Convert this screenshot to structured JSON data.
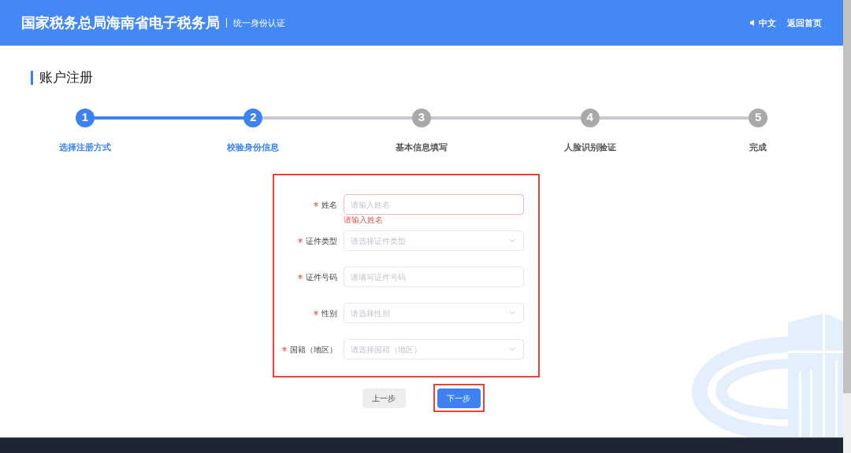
{
  "header": {
    "title": "国家税务总局海南省电子税务局",
    "subtitle": "统一身份认证",
    "language": "中文",
    "home_link": "返回首页"
  },
  "page_title": "账户注册",
  "steps": [
    {
      "number": "1",
      "label": "选择注册方式",
      "completed": true
    },
    {
      "number": "2",
      "label": "校验身份信息",
      "completed": true
    },
    {
      "number": "3",
      "label": "基本信息填写",
      "completed": false
    },
    {
      "number": "4",
      "label": "人脸识别验证",
      "completed": false
    },
    {
      "number": "5",
      "label": "完成",
      "completed": false
    }
  ],
  "form": {
    "highlighted": true,
    "fields": [
      {
        "kind": "input",
        "label": "姓名",
        "required": true,
        "placeholder": "请输入姓名",
        "invalid": true,
        "error": "请输入姓名"
      },
      {
        "kind": "select",
        "label": "证件类型",
        "required": true,
        "placeholder": "请选择证件类型",
        "invalid": false
      },
      {
        "kind": "input",
        "label": "证件号码",
        "required": true,
        "placeholder": "请填写证件号码",
        "invalid": false
      },
      {
        "kind": "select",
        "label": "性别",
        "required": true,
        "placeholder": "请选择性别",
        "invalid": false
      },
      {
        "kind": "select",
        "label": "国籍（地区）",
        "required": true,
        "placeholder": "请选择国籍（地区）",
        "invalid": false
      }
    ]
  },
  "buttons": [
    {
      "kind": "secondary",
      "label": "上一步",
      "highlighted": false
    },
    {
      "kind": "primary",
      "label": "下一步",
      "highlighted": true
    }
  ]
}
